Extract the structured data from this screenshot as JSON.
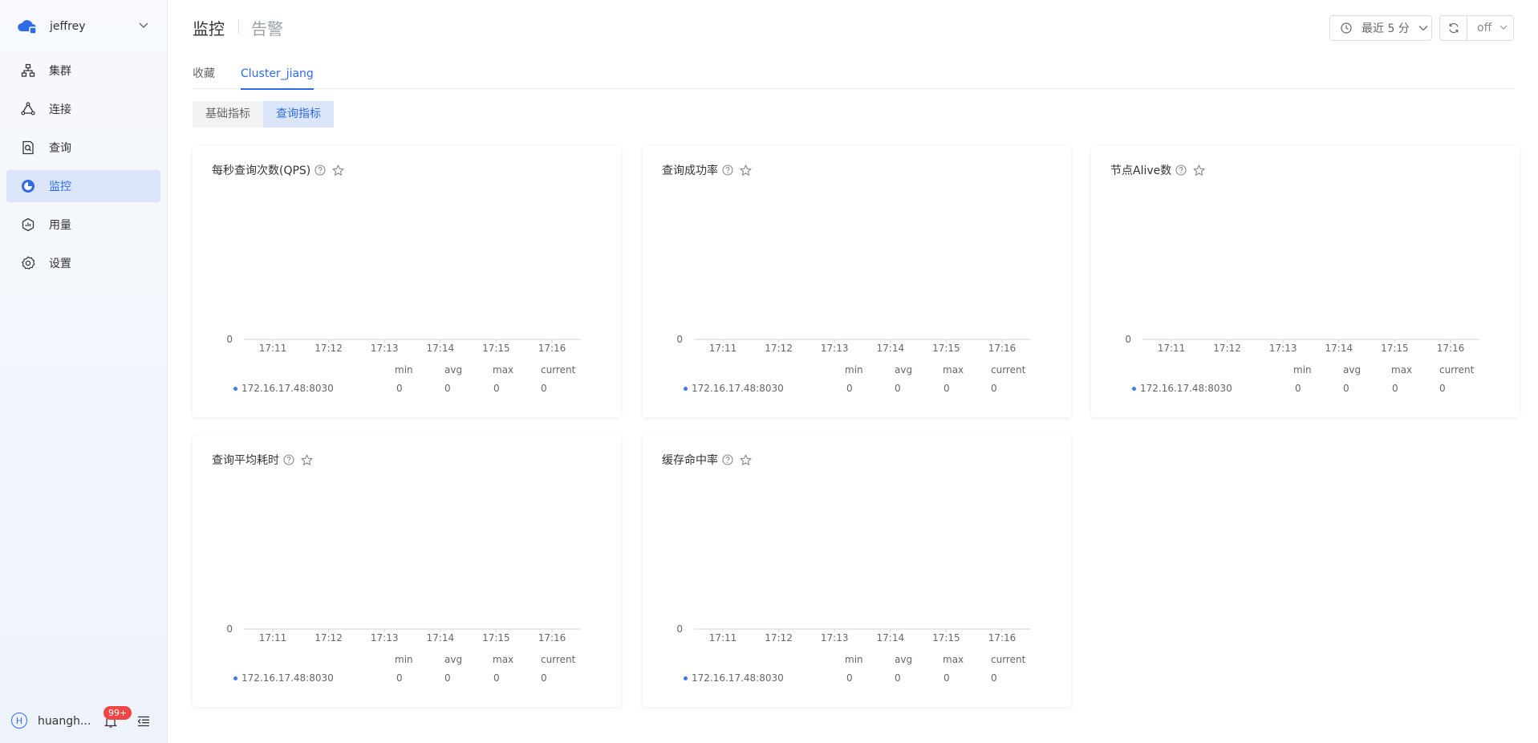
{
  "sidebar": {
    "account": "jeffrey",
    "items": [
      {
        "label": "集群",
        "icon": "cluster-icon"
      },
      {
        "label": "连接",
        "icon": "connect-icon"
      },
      {
        "label": "查询",
        "icon": "query-icon"
      },
      {
        "label": "监控",
        "icon": "monitor-icon"
      },
      {
        "label": "用量",
        "icon": "usage-icon"
      },
      {
        "label": "设置",
        "icon": "settings-icon"
      }
    ],
    "active_index": 3,
    "user_initial": "H",
    "user_name": "huangh...",
    "notification_badge": "99+"
  },
  "header": {
    "title": "监控",
    "alert_tab": "告警",
    "time_range": "最近 5 分",
    "auto_refresh": "off"
  },
  "tabs": [
    {
      "label": "收藏"
    },
    {
      "label": "Cluster_jiang"
    }
  ],
  "segments": {
    "basic": "基础指标",
    "query": "查询指标"
  },
  "colors": {
    "accent": "#2f6be6",
    "series": "#3d7af5"
  },
  "legend_headers": {
    "min": "min",
    "avg": "avg",
    "max": "max",
    "current": "current"
  },
  "cards": [
    {
      "title": "每秒查询次数(QPS)",
      "series": "172.16.17.48:8030",
      "min": "0",
      "avg": "0",
      "max": "0",
      "current": "0"
    },
    {
      "title": "查询成功率",
      "series": "172.16.17.48:8030",
      "min": "0",
      "avg": "0",
      "max": "0",
      "current": "0"
    },
    {
      "title": "节点Alive数",
      "series": "172.16.17.48:8030",
      "min": "0",
      "avg": "0",
      "max": "0",
      "current": "0"
    },
    {
      "title": "查询平均耗时",
      "series": "172.16.17.48:8030",
      "min": "0",
      "avg": "0",
      "max": "0",
      "current": "0"
    },
    {
      "title": "缓存命中率",
      "series": "172.16.17.48:8030",
      "min": "0",
      "avg": "0",
      "max": "0",
      "current": "0"
    }
  ],
  "chart_data": [
    {
      "type": "line",
      "title": "每秒查询次数(QPS)",
      "categories": [
        "17:11",
        "17:12",
        "17:13",
        "17:14",
        "17:15",
        "17:16"
      ],
      "y_tick_labels": [
        "0"
      ],
      "series": [
        {
          "name": "172.16.17.48:8030",
          "values": [
            0,
            0,
            0,
            0,
            0,
            0
          ]
        }
      ]
    },
    {
      "type": "line",
      "title": "查询成功率",
      "categories": [
        "17:11",
        "17:12",
        "17:13",
        "17:14",
        "17:15",
        "17:16"
      ],
      "y_tick_labels": [
        "0"
      ],
      "series": [
        {
          "name": "172.16.17.48:8030",
          "values": [
            0,
            0,
            0,
            0,
            0,
            0
          ]
        }
      ]
    },
    {
      "type": "line",
      "title": "节点Alive数",
      "categories": [
        "17:11",
        "17:12",
        "17:13",
        "17:14",
        "17:15",
        "17:16"
      ],
      "y_tick_labels": [
        "0"
      ],
      "series": [
        {
          "name": "172.16.17.48:8030",
          "values": [
            0,
            0,
            0,
            0,
            0,
            0
          ]
        }
      ]
    },
    {
      "type": "line",
      "title": "查询平均耗时",
      "categories": [
        "17:11",
        "17:12",
        "17:13",
        "17:14",
        "17:15",
        "17:16"
      ],
      "y_tick_labels": [
        "0"
      ],
      "series": [
        {
          "name": "172.16.17.48:8030",
          "values": [
            0,
            0,
            0,
            0,
            0,
            0
          ]
        }
      ]
    },
    {
      "type": "line",
      "title": "缓存命中率",
      "categories": [
        "17:11",
        "17:12",
        "17:13",
        "17:14",
        "17:15",
        "17:16"
      ],
      "y_tick_labels": [
        "0"
      ],
      "series": [
        {
          "name": "172.16.17.48:8030",
          "values": [
            0,
            0,
            0,
            0,
            0,
            0
          ]
        }
      ]
    }
  ]
}
